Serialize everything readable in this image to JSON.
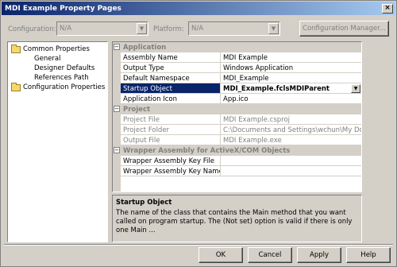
{
  "window": {
    "title": "MDI Example Property Pages",
    "close_glyph": "×"
  },
  "toolbar": {
    "configuration_label": "Configuration:",
    "configuration_value": "N/A",
    "platform_label": "Platform:",
    "platform_value": "N/A",
    "configuration_manager_label": "Configuration Manager..."
  },
  "tree": {
    "items": [
      {
        "label": "Common Properties"
      },
      {
        "label": "General"
      },
      {
        "label": "Designer Defaults"
      },
      {
        "label": "References Path"
      },
      {
        "label": "Configuration Properties"
      }
    ]
  },
  "grid": {
    "categories": [
      {
        "label": "Application",
        "toggle": "−"
      },
      {
        "label": "Project",
        "toggle": "−"
      },
      {
        "label": "Wrapper Assembly for ActiveX/COM Objects",
        "toggle": "−"
      }
    ],
    "application": [
      {
        "name": "Assembly Name",
        "value": "MDI Example"
      },
      {
        "name": "Output Type",
        "value": "Windows Application"
      },
      {
        "name": "Default Namespace",
        "value": "MDI_Example"
      },
      {
        "name": "Startup Object",
        "value": "MDI_Example.fclsMDIParent"
      },
      {
        "name": "Application Icon",
        "value": "App.ico"
      }
    ],
    "project": [
      {
        "name": "Project File",
        "value": "MDI Example.csproj"
      },
      {
        "name": "Project Folder",
        "value": "C:\\Documents and Settings\\wchun\\My Docume"
      },
      {
        "name": "Output File",
        "value": "MDI Example.exe"
      }
    ],
    "wrapper": [
      {
        "name": "Wrapper Assembly Key File",
        "value": ""
      },
      {
        "name": "Wrapper Assembly Key Name",
        "value": ""
      }
    ]
  },
  "description": {
    "title": "Startup Object",
    "text": "The name of the class that contains the Main method that you want called on program startup. The (Not set) option is valid if there is only one Main ..."
  },
  "buttons": {
    "ok": "OK",
    "cancel": "Cancel",
    "apply": "Apply",
    "help": "Help"
  }
}
